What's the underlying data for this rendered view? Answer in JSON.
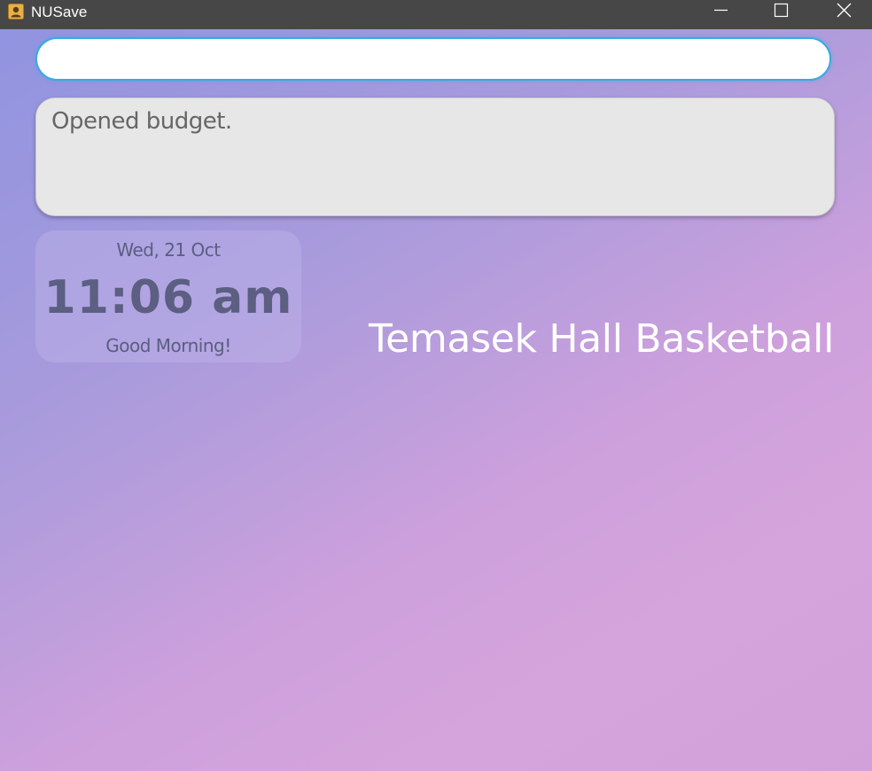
{
  "window": {
    "title": "NUSave",
    "icons": {
      "app": "contact-card-icon",
      "minimize": "minimize-icon",
      "maximize": "maximize-icon",
      "close": "close-icon"
    }
  },
  "command_input": {
    "value": "",
    "placeholder": ""
  },
  "result_display": {
    "text": "Opened budget."
  },
  "clock": {
    "date": "Wed, 21 Oct",
    "time": "11:06 am",
    "greeting": "Good Morning!"
  },
  "budget": {
    "title": "Temasek Hall Basketball"
  },
  "colors": {
    "titlebar": "#474747",
    "input_border": "#3aa9e0",
    "result_bg": "#e7e7e7",
    "gradient_start": "#8f93e0",
    "gradient_end": "#d6a4dc"
  }
}
